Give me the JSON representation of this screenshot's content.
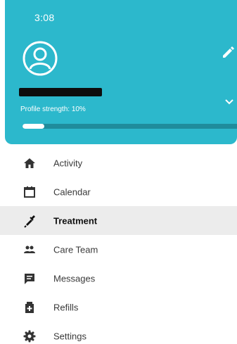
{
  "status_bar": {
    "time": "3:08"
  },
  "profile": {
    "strength_text": "Profile strength: 10%",
    "strength_fraction": 0.1
  },
  "menu": {
    "items": [
      {
        "label": "Activity",
        "icon": "home-icon"
      },
      {
        "label": "Calendar",
        "icon": "calendar-icon"
      },
      {
        "label": "Treatment",
        "icon": "syringe-icon",
        "active": true
      },
      {
        "label": "Care Team",
        "icon": "group-icon"
      },
      {
        "label": "Messages",
        "icon": "message-icon"
      },
      {
        "label": "Refills",
        "icon": "medical-bag-icon"
      },
      {
        "label": "Settings",
        "icon": "gear-icon"
      }
    ]
  },
  "colors": {
    "header": "#2cb8cc",
    "active_row": "#ececec",
    "icon": "#333333"
  }
}
